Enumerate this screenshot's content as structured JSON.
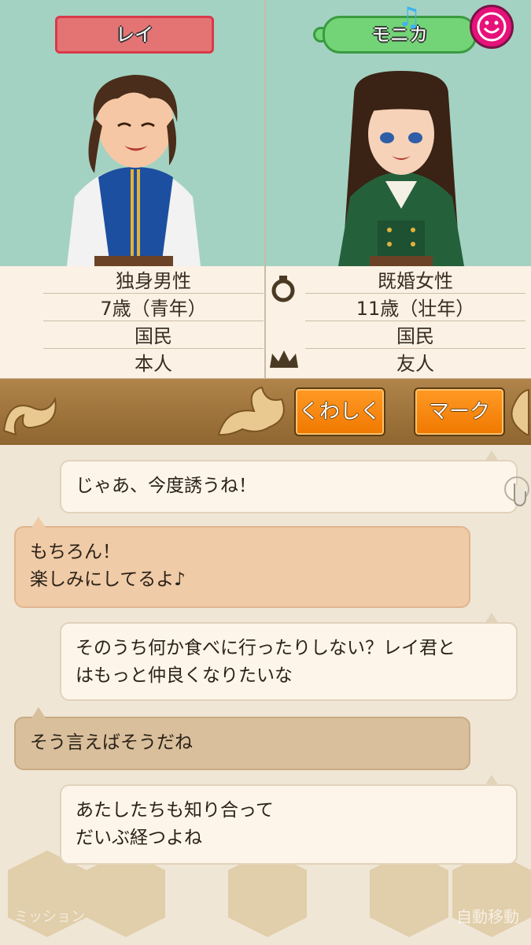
{
  "characters": {
    "left": {
      "name": "レイ",
      "marital": "独身男性",
      "age": "7歳（青年）",
      "status": "国民",
      "relation": "本人"
    },
    "right": {
      "name": "モニカ",
      "marital": "既婚女性",
      "age": "11歳（壮年）",
      "status": "国民",
      "relation": "友人"
    }
  },
  "buttons": {
    "details": "くわしく",
    "mark": "マーク"
  },
  "chat": [
    {
      "side": "right",
      "text": "じゃあ、今度誘うね！"
    },
    {
      "side": "left",
      "text": "もちろん！\n楽しみにしてるよ♪"
    },
    {
      "side": "right",
      "text": "そのうち何か食べに行ったりしない？レイ君と\nはもっと仲良くなりたいな"
    },
    {
      "side": "left",
      "text": "そう言えばそうだね"
    },
    {
      "side": "right",
      "text": "あたしたちも知り合って\nだいぶ経つよね"
    }
  ],
  "background_menu": {
    "mission": "ミッション",
    "auto_move": "自動移動"
  },
  "colors": {
    "panel_bg": "#a4d2c2",
    "left_name_tag": "#e47474",
    "right_name_tag": "#73d477",
    "button_orange": "#f07800",
    "mood_icon": "#e6127a"
  },
  "icons": [
    "music-note-icon",
    "smiley-mood-icon",
    "ring-icon",
    "crown-icon",
    "touch-hand-icon"
  ]
}
